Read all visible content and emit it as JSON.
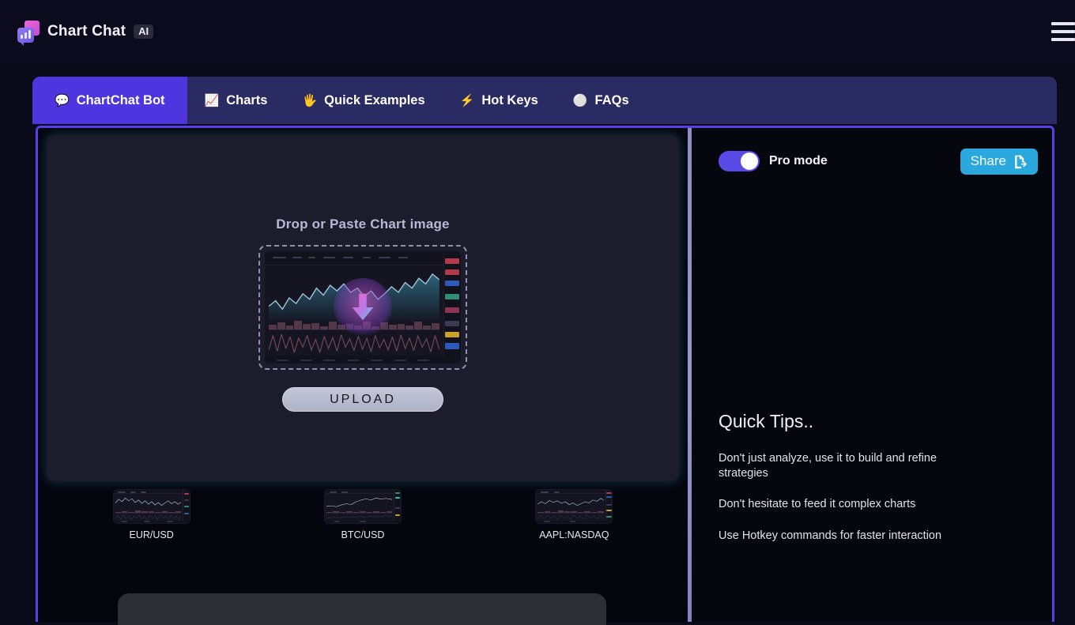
{
  "header": {
    "brand_name": "Chart Chat",
    "brand_badge": "AI",
    "logo_icon": "chart-chat-logo-icon",
    "menu_icon": "hamburger-menu-icon"
  },
  "tabs": [
    {
      "icon": "speech-balloon-icon",
      "glyph": "💬",
      "label": "ChartChat Bot",
      "active": true
    },
    {
      "icon": "chart-increasing-icon",
      "glyph": "📈",
      "label": "Charts",
      "active": false
    },
    {
      "icon": "raised-hand-icon",
      "glyph": "🖐",
      "label": "Quick Examples",
      "active": false
    },
    {
      "icon": "lightning-bolt-icon",
      "glyph": "⚡",
      "label": "Hot Keys",
      "active": false
    },
    {
      "icon": "white-circle-icon",
      "glyph": "⚪",
      "label": "FAQs",
      "active": false
    }
  ],
  "dropzone": {
    "title": "Drop or Paste Chart image",
    "download_icon": "download-arrow-icon",
    "preview_icon": "chart-preview-thumbnail",
    "upload_label": "UPLOAD"
  },
  "examples": [
    {
      "label": "EUR/USD"
    },
    {
      "label": "BTC/USD"
    },
    {
      "label": "AAPL:NASDAQ"
    }
  ],
  "rightPanel": {
    "pro_mode_label": "Pro mode",
    "pro_mode_on": true,
    "share_label": "Share",
    "share_icon": "file-export-icon",
    "tips_title": "Quick Tips..",
    "tips": [
      "Don't just analyze, use it to build and refine strategies",
      "Don't hesitate to feed it complex charts",
      "Use Hotkey commands for faster interaction"
    ]
  },
  "colors": {
    "page_bg": "#0a0a1a",
    "tabbar_bg": "#2b2b63",
    "active_tab": "#4f35e0",
    "panel_border": "#5a3fe8",
    "share_button": "#29a8dd",
    "toggle_on": "#5a4ae8",
    "divider": "#9a9ad0",
    "upload_button": "#b7bacb"
  }
}
